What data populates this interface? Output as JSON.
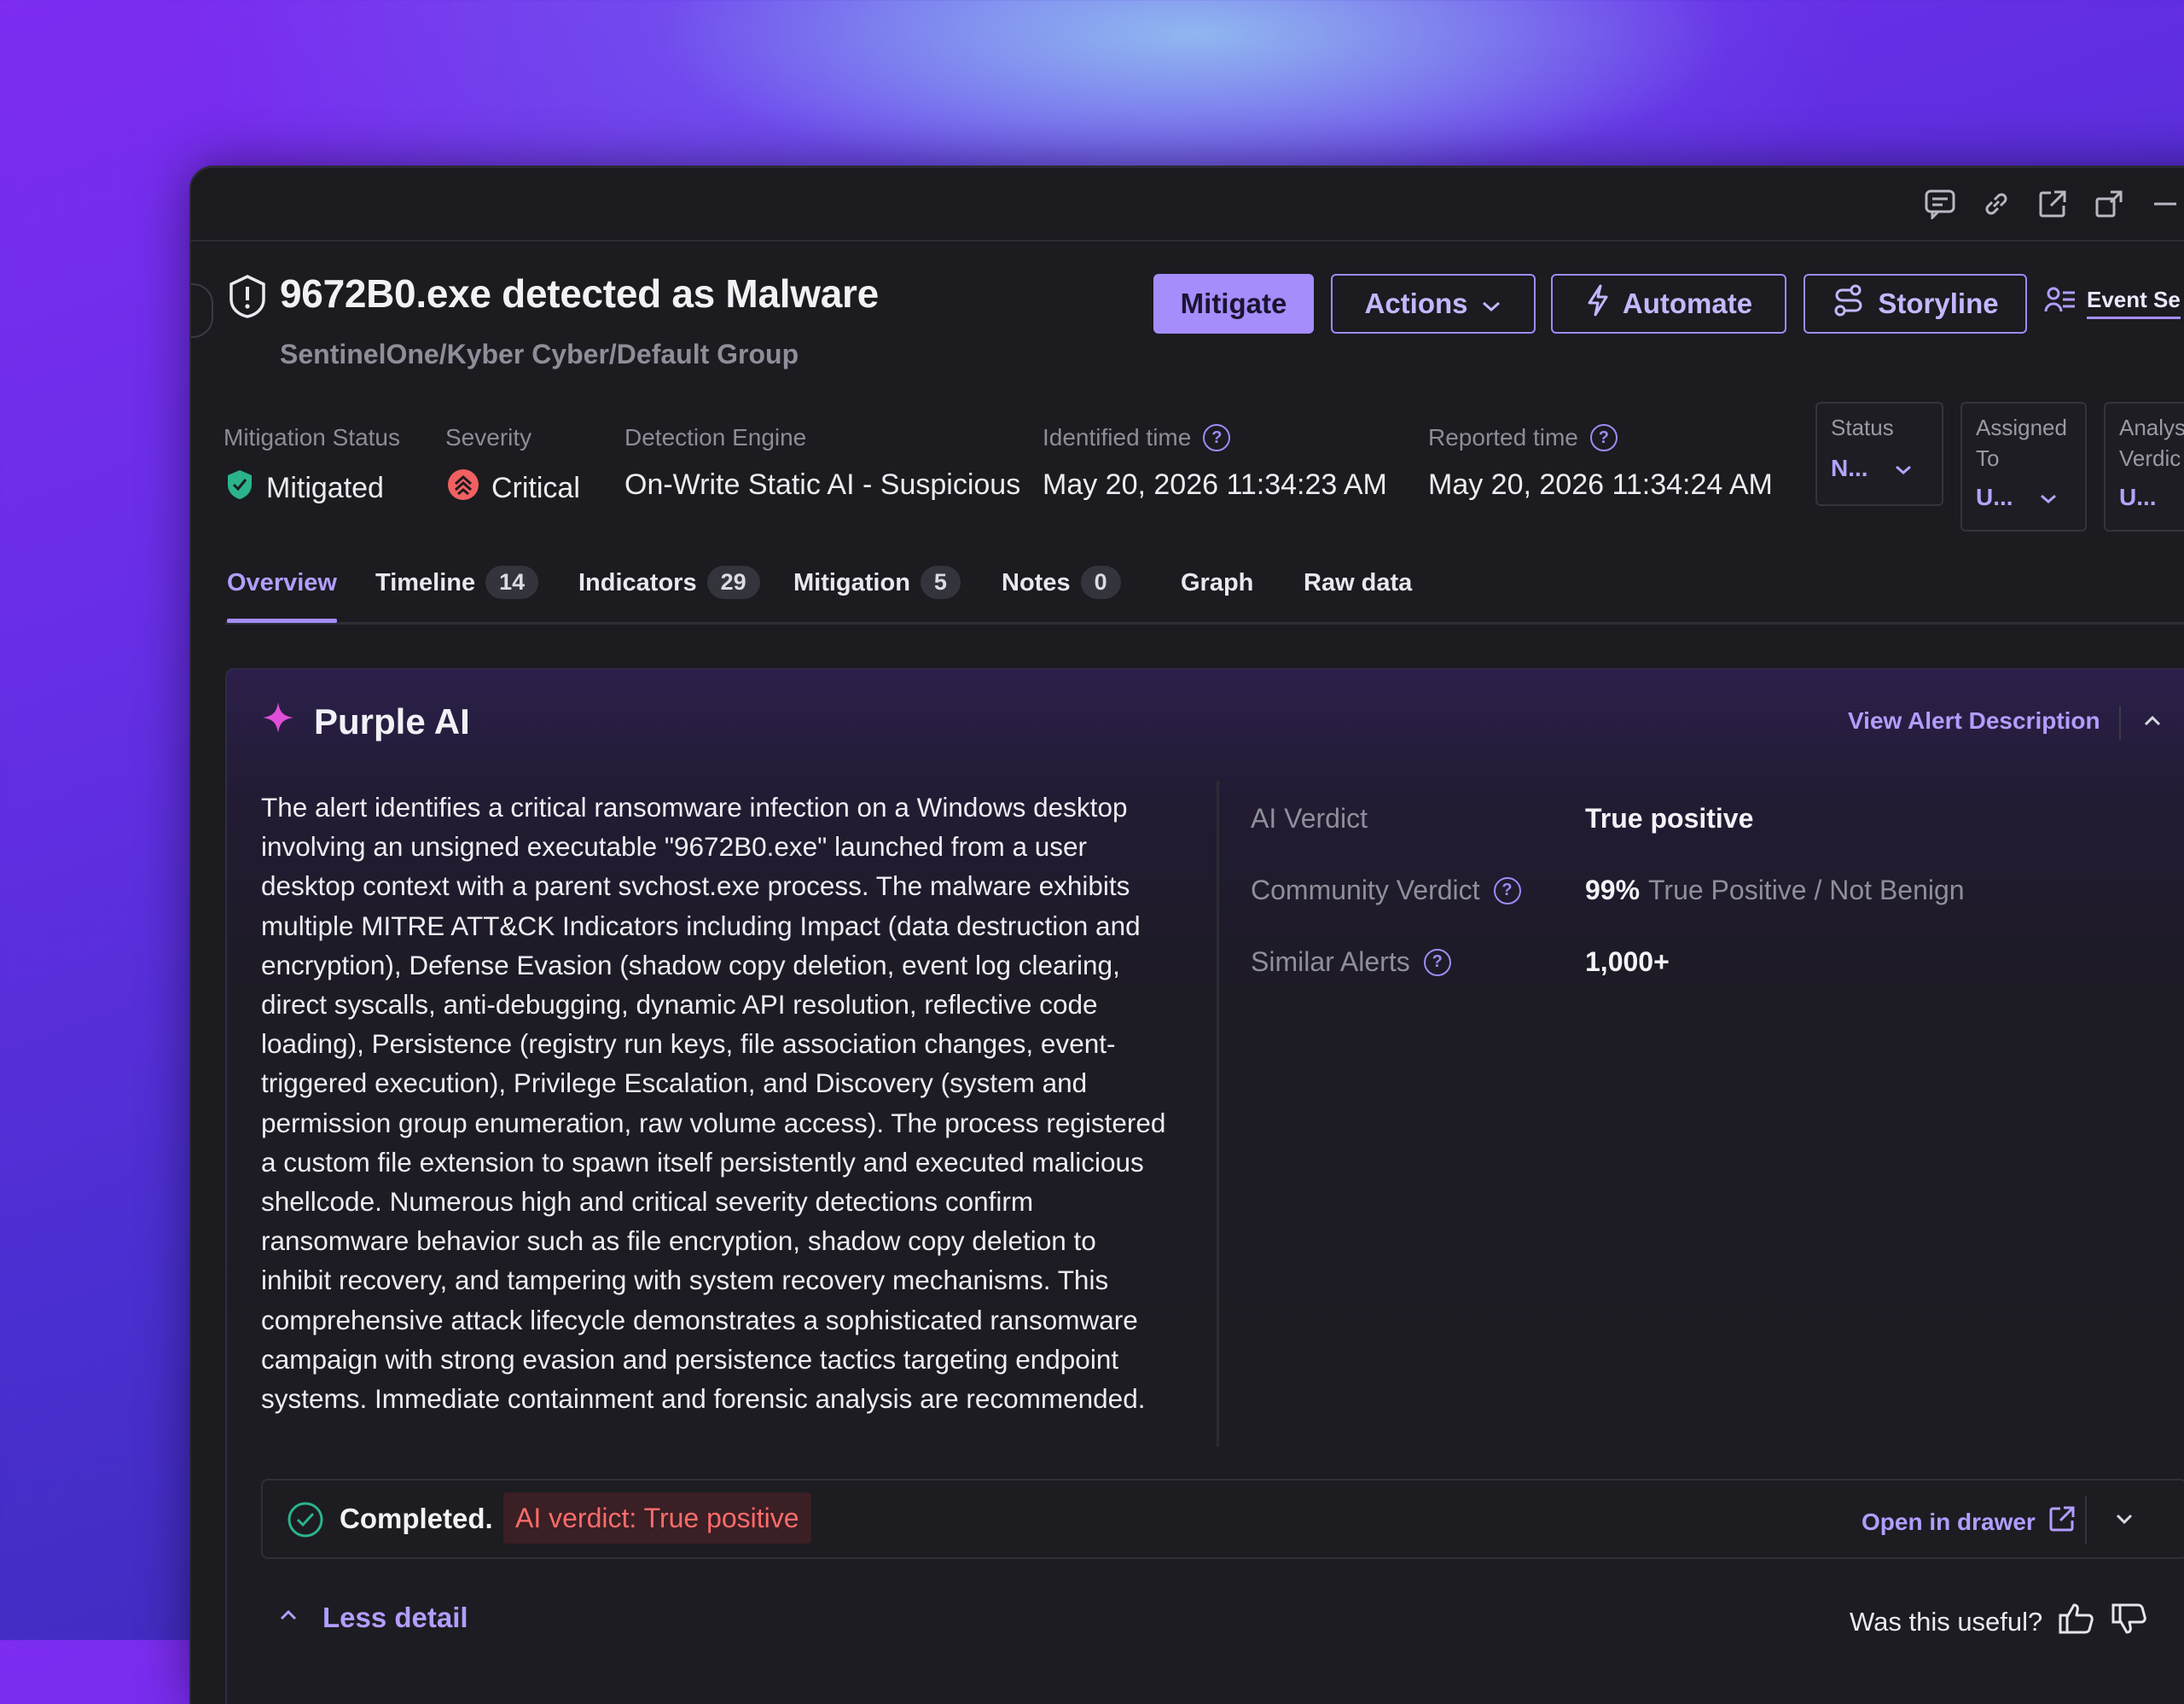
{
  "alert": {
    "title": "9672B0.exe detected as Malware",
    "path": "SentinelOne/Kyber Cyber/Default Group"
  },
  "toolbar": {
    "mitigate": "Mitigate",
    "actions": "Actions",
    "automate": "Automate",
    "storyline": "Storyline",
    "event_search": "Event Se"
  },
  "meta": {
    "mitigation_status_label": "Mitigation Status",
    "mitigation_status_value": "Mitigated",
    "severity_label": "Severity",
    "severity_value": "Critical",
    "engine_label": "Detection Engine",
    "engine_value": "On-Write Static AI - Suspicious",
    "identified_label": "Identified time",
    "identified_value": "May 20, 2026 11:34:23 AM",
    "reported_label": "Reported time",
    "reported_value": "May 20, 2026 11:34:24 AM"
  },
  "dropdowns": {
    "status_label": "Status",
    "status_value": "N...",
    "assigned_label_1": "Assigned",
    "assigned_label_2": "To",
    "assigned_value": "U...",
    "verdict_label_1": "Analys",
    "verdict_label_2": "Verdic",
    "verdict_value": "U..."
  },
  "tabs": [
    {
      "label": "Overview",
      "count": null
    },
    {
      "label": "Timeline",
      "count": "14"
    },
    {
      "label": "Indicators",
      "count": "29"
    },
    {
      "label": "Mitigation",
      "count": "5"
    },
    {
      "label": "Notes",
      "count": "0"
    },
    {
      "label": "Graph",
      "count": null
    },
    {
      "label": "Raw data",
      "count": null
    }
  ],
  "purple_ai": {
    "title": "Purple AI",
    "view_description": "View Alert Description",
    "lines": [
      "The alert identifies a critical ransomware infection on a Windows desktop",
      "involving an unsigned executable \"9672B0.exe\" launched from a user",
      "desktop context with a parent svchost.exe process. The malware exhibits",
      "multiple MITRE ATT&CK Indicators including Impact (data destruction and",
      "encryption), Defense Evasion (shadow copy deletion, event log clearing,",
      "direct syscalls, anti-debugging, dynamic API resolution, reflective code",
      "loading), Persistence (registry run keys, file association changes, event-",
      "triggered execution), Privilege Escalation, and Discovery (system and",
      "permission group enumeration, raw volume access). The process registered",
      "a custom file extension to spawn itself persistently and executed malicious",
      "shellcode. Numerous high and critical severity detections confirm",
      "ransomware behavior such as file encryption, shadow copy deletion to",
      "inhibit recovery, and tampering with system recovery mechanisms. This",
      "comprehensive attack lifecycle demonstrates a sophisticated ransomware",
      "campaign with strong evasion and persistence tactics targeting endpoint",
      "systems. Immediate containment and forensic analysis are recommended."
    ],
    "ai_verdict_label": "AI Verdict",
    "ai_verdict_value": "True positive",
    "community_label": "Community Verdict",
    "community_pct": "99%",
    "community_text": "True Positive / Not Benign",
    "similar_label": "Similar Alerts",
    "similar_value": "1,000+",
    "completed": "Completed.",
    "verdict_chip": "AI verdict: True positive",
    "open_drawer": "Open in drawer",
    "less_detail": "Less detail",
    "useful": "Was this useful?"
  },
  "colors": {
    "accent": "#a58dfc",
    "critical": "#ff6b6b",
    "mitigated": "#2bb38d"
  }
}
